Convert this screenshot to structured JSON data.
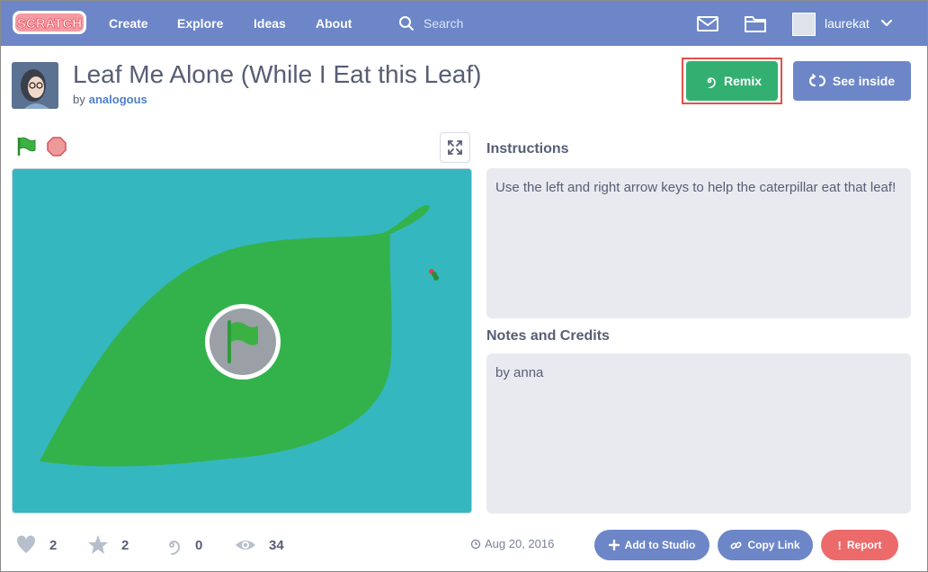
{
  "nav": {
    "logo_text": "SCRATCH",
    "links": [
      {
        "label": "Create"
      },
      {
        "label": "Explore"
      },
      {
        "label": "Ideas"
      },
      {
        "label": "About"
      }
    ],
    "search_placeholder": "Search",
    "username": "laurekat",
    "icons": [
      "search-icon",
      "messages-icon",
      "my-stuff-folder-icon",
      "chevron-down-icon"
    ]
  },
  "project": {
    "title": "Leaf Me Alone (While I Eat this Leaf)",
    "by_label": "by",
    "author": "analogous",
    "remix_label": "Remix",
    "see_inside_label": "See inside"
  },
  "stage": {
    "controls": [
      "green-flag-icon",
      "stop-icon",
      "fullscreen-icon"
    ],
    "colors": {
      "background": "#35b7bf",
      "leaf": "#33b24c",
      "flag_circle": "#9aa0a6"
    }
  },
  "instructions": {
    "title": "Instructions",
    "text": "Use the left and right arrow keys to help the caterpillar eat that leaf!"
  },
  "notes": {
    "title": "Notes and Credits",
    "text": "by anna"
  },
  "stats": {
    "loves": "2",
    "favorites": "2",
    "remixes": "0",
    "views": "34"
  },
  "share": {
    "date": "Aug 20, 2016",
    "add_to_studio": "Add to Studio",
    "copy_link": "Copy Link",
    "report": "Report"
  },
  "colors": {
    "nav": "#6c86c8",
    "remix": "#33b071",
    "remix_highlight": "#e0514a",
    "report": "#ec6a6a",
    "pill_blue": "#6c86c8"
  }
}
